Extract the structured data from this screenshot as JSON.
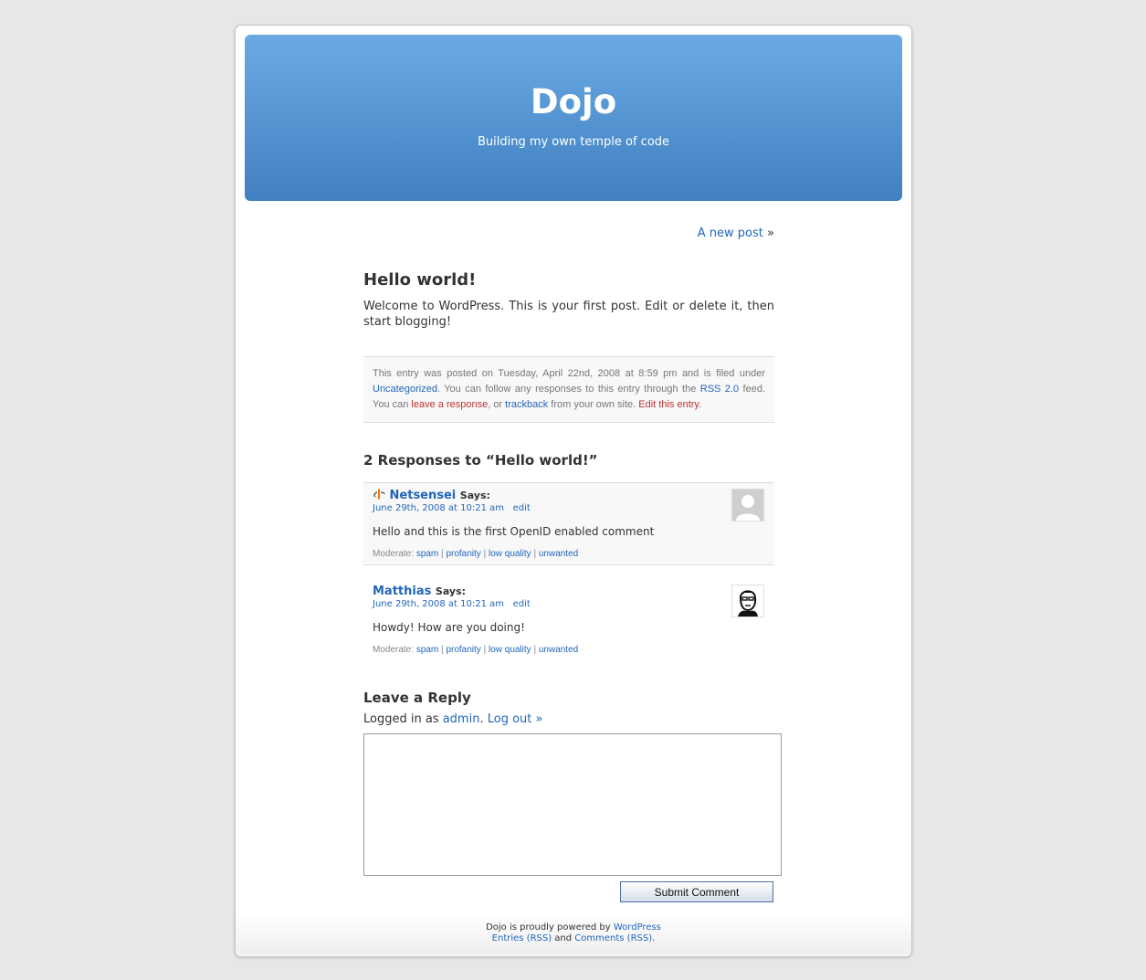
{
  "header": {
    "title": "Dojo",
    "description": "Building my own temple of code",
    "colors": {
      "gradient_top": "#6aaae4",
      "gradient_bottom": "#4180c0"
    }
  },
  "navigation": {
    "next_link": "A new post",
    "next_arrow": "»"
  },
  "post": {
    "title": "Hello world!",
    "body": "Welcome to WordPress. This is your first post. Edit or delete it, then start blogging!",
    "meta": {
      "text1": "This entry was posted on Tuesday, April 22nd, 2008 at 8:59 pm and is filed under ",
      "category_link": "Uncategorized",
      "text2": ". You can follow any responses to this entry through the ",
      "rss_link": "RSS 2.0",
      "text3": " feed. You can ",
      "leave_response_link": "leave a response",
      "text4": ", or ",
      "trackback_link": "trackback",
      "text5": " from your own site. ",
      "edit_link": "Edit this entry",
      "text6": "."
    }
  },
  "comments": {
    "title": "2 Responses to “Hello world!”",
    "says": "Says:",
    "items": [
      {
        "author": "Netsensei",
        "date": "June 29th, 2008 at 10:21 am",
        "edit": "edit",
        "text": "Hello and this is the first OpenID enabled comment",
        "openid_icon": "openid-icon",
        "avatar": "default-avatar"
      },
      {
        "author": "Matthias",
        "date": "June 29th, 2008 at 10:21 am",
        "edit": "edit",
        "text": "Howdy! How are you doing!",
        "avatar": "user-photo-avatar"
      }
    ],
    "moderate": {
      "label": "Moderate:",
      "spam": "spam",
      "profanity": "profanity",
      "low_quality": "low quality",
      "unwanted": "unwanted",
      "separator": "|"
    }
  },
  "reply": {
    "title": "Leave a Reply",
    "logged_in_text": "Logged in as ",
    "user_link": "admin",
    "period": ".",
    "logout_link": "Log out »",
    "textarea_value": "",
    "submit_label": "Submit Comment"
  },
  "footer": {
    "powered_text": "Dojo is proudly powered by ",
    "wordpress_link": "WordPress",
    "entries_link": "Entries (RSS)",
    "and_text": " and ",
    "comments_link": "Comments (RSS)",
    "period": "."
  },
  "colors": {
    "link": "#2266bb",
    "alert_link": "#bb3333",
    "background": "#e7e7e7"
  }
}
